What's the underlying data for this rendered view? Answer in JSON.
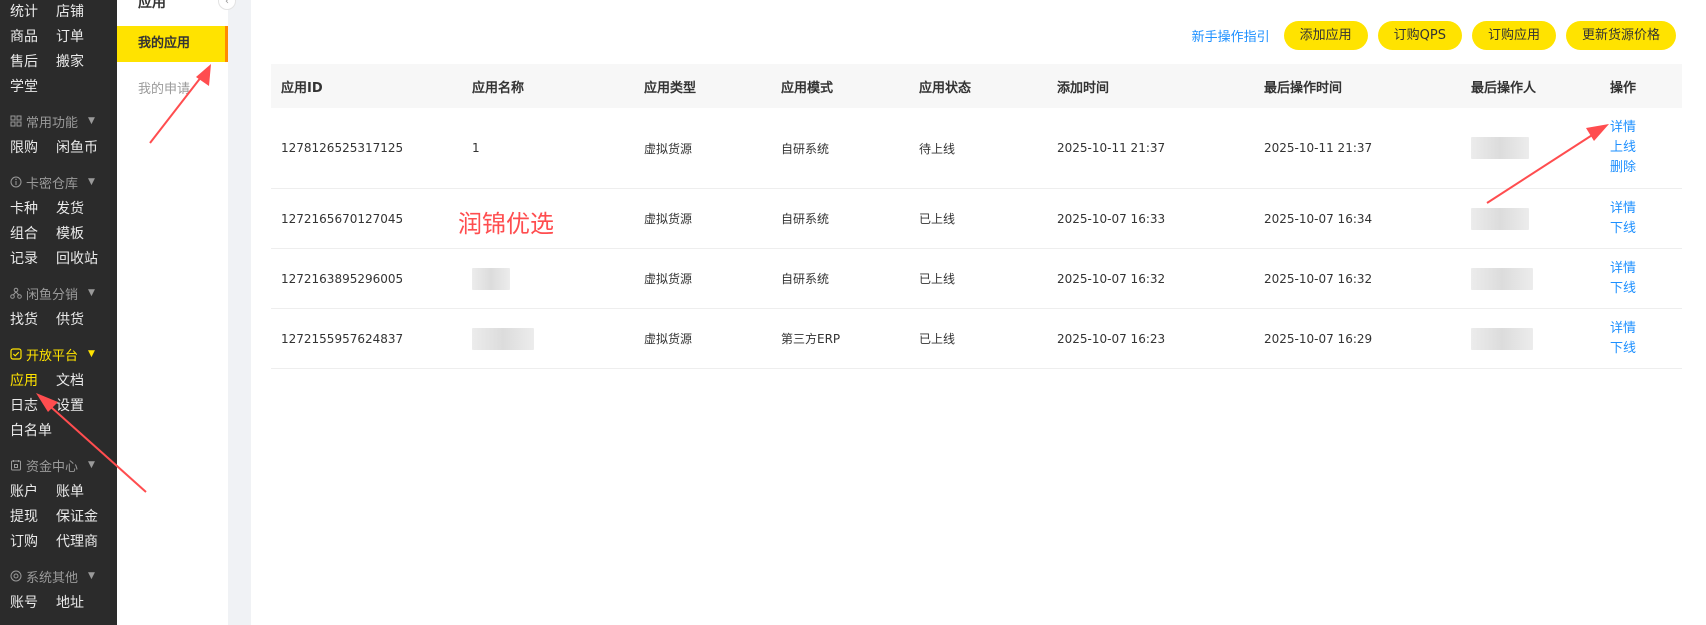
{
  "sidebar": {
    "top_items": [
      "统计",
      "店铺",
      "商品",
      "订单",
      "售后",
      "搬家",
      "学堂"
    ],
    "sections": [
      {
        "title": "常用功能",
        "icon": "grid-icon",
        "items": [
          "限购",
          "闲鱼币"
        ]
      },
      {
        "title": "卡密仓库",
        "icon": "info-icon",
        "items": [
          "卡种",
          "发货",
          "组合",
          "模板",
          "记录",
          "回收站"
        ]
      },
      {
        "title": "闲鱼分销",
        "icon": "network-icon",
        "items": [
          "找货",
          "供货"
        ]
      },
      {
        "title": "开放平台",
        "icon": "check-square-icon",
        "items": [
          "应用",
          "文档",
          "日志",
          "设置",
          "白名单"
        ],
        "open": true,
        "active_item": "应用"
      },
      {
        "title": "资金中心",
        "icon": "wallet-icon",
        "items": [
          "账户",
          "账单",
          "提现",
          "保证金",
          "订购",
          "代理商"
        ]
      },
      {
        "title": "系统其他",
        "icon": "settings-circle-icon",
        "items": [
          "账号",
          "地址"
        ]
      }
    ]
  },
  "subnav": {
    "title": "应用",
    "collapse_icon": "chevron-left-icon",
    "active": "我的应用",
    "second": "我的申请"
  },
  "top_actions": {
    "guide": "新手操作指引",
    "add_app": "添加应用",
    "buy_qps": "订购QPS",
    "buy_app": "订购应用",
    "update_price": "更新货源价格"
  },
  "table": {
    "headers": [
      "应用ID",
      "应用名称",
      "应用类型",
      "应用模式",
      "应用状态",
      "添加时间",
      "最后操作时间",
      "最后操作人",
      "操作"
    ],
    "rows": [
      {
        "id": "1278126525317125",
        "name": "1",
        "type": "虚拟货源",
        "mode": "自研系统",
        "status": "待上线",
        "added": "2025-10-11 21:37",
        "last": "2025-10-11 21:37",
        "ops": [
          "详情",
          "上线",
          "删除"
        ]
      },
      {
        "id": "1272165670127045",
        "name": "",
        "type": "虚拟货源",
        "mode": "自研系统",
        "status": "已上线",
        "added": "2025-10-07 16:33",
        "last": "2025-10-07 16:34",
        "ops": [
          "详情",
          "下线"
        ]
      },
      {
        "id": "1272163895296005",
        "name": "",
        "type": "虚拟货源",
        "mode": "自研系统",
        "status": "已上线",
        "added": "2025-10-07 16:32",
        "last": "2025-10-07 16:32",
        "ops": [
          "详情",
          "下线"
        ]
      },
      {
        "id": "1272155957624837",
        "name": "",
        "type": "虚拟货源",
        "mode": "第三方ERP",
        "status": "已上线",
        "added": "2025-10-07 16:23",
        "last": "2025-10-07 16:29",
        "ops": [
          "详情",
          "下线"
        ]
      }
    ]
  },
  "watermark": "润锦优选",
  "colors": {
    "accent": "#ffe300",
    "link": "#1e90ff",
    "sidebar_bg": "#2b2b2b",
    "arrow": "#ff4d4f"
  }
}
